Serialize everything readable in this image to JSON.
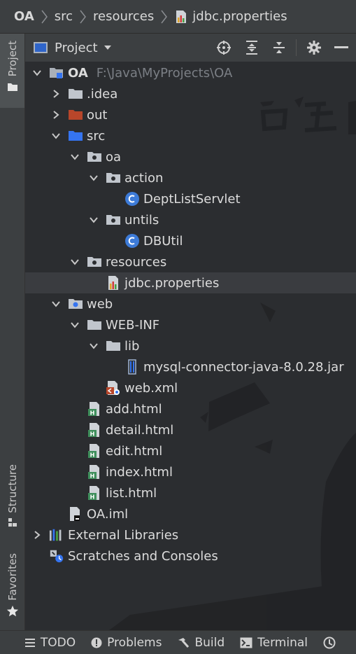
{
  "breadcrumb": {
    "items": [
      "OA",
      "src",
      "resources",
      "jdbc.properties"
    ]
  },
  "left_strip": {
    "project": "Project",
    "structure": "Structure",
    "favorites": "Favorites"
  },
  "toolbar": {
    "view_label": "Project",
    "icons": [
      "locate-icon",
      "expand-all-icon",
      "collapse-all-icon",
      "gear-icon",
      "minimize-icon"
    ]
  },
  "tree": {
    "rows": [
      {
        "label": "OA",
        "path": "F:\\Java\\MyProjects\\OA",
        "icon": "module-folder-icon"
      },
      {
        "label": ".idea",
        "icon": "folder-icon"
      },
      {
        "label": "out",
        "icon": "excluded-folder-icon"
      },
      {
        "label": "src",
        "icon": "source-folder-icon"
      },
      {
        "label": "oa",
        "icon": "package-icon"
      },
      {
        "label": "action",
        "icon": "package-icon"
      },
      {
        "label": "DeptListServlet",
        "icon": "class-icon"
      },
      {
        "label": "untils",
        "icon": "package-icon"
      },
      {
        "label": "DBUtil",
        "icon": "class-icon"
      },
      {
        "label": "resources",
        "icon": "resources-folder-icon"
      },
      {
        "label": "jdbc.properties",
        "icon": "properties-file-icon"
      },
      {
        "label": "web",
        "icon": "web-folder-icon"
      },
      {
        "label": "WEB-INF",
        "icon": "folder-icon"
      },
      {
        "label": "lib",
        "icon": "folder-icon"
      },
      {
        "label": "mysql-connector-java-8.0.28.jar",
        "icon": "jar-icon"
      },
      {
        "label": "web.xml",
        "icon": "xml-file-icon"
      },
      {
        "label": "add.html",
        "icon": "html-file-icon"
      },
      {
        "label": "detail.html",
        "icon": "html-file-icon"
      },
      {
        "label": "edit.html",
        "icon": "html-file-icon"
      },
      {
        "label": "index.html",
        "icon": "html-file-icon"
      },
      {
        "label": "list.html",
        "icon": "html-file-icon"
      },
      {
        "label": "OA.iml",
        "icon": "iml-file-icon"
      },
      {
        "label": "External Libraries",
        "icon": "libraries-icon"
      },
      {
        "label": "Scratches and Consoles",
        "icon": "scratches-icon"
      }
    ],
    "selected": "jdbc.properties"
  },
  "bottom_bar": {
    "todo": "TODO",
    "problems": "Problems",
    "build": "Build",
    "terminal": "Terminal"
  },
  "colors": {
    "accent": "#3574f0",
    "background": "#2b2d30",
    "panel": "#3c3f41",
    "class_icon": "#3d7bd8",
    "out_folder": "#b8462a",
    "html_icon": "#3f8f5c"
  }
}
